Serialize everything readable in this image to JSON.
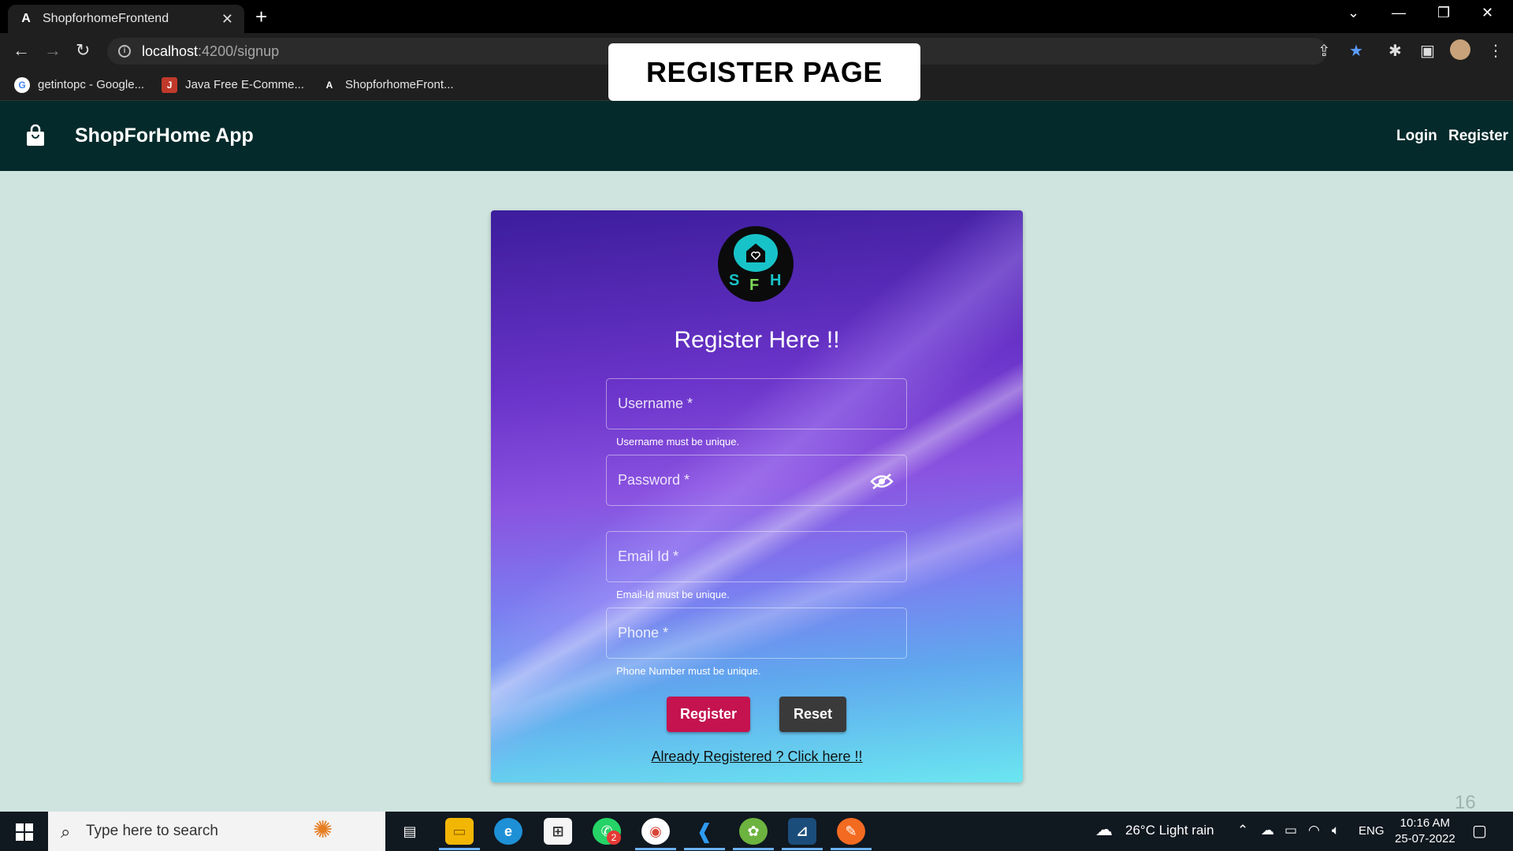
{
  "browser": {
    "tab_title": "ShopforhomeFrontend",
    "url_host": "localhost",
    "url_path": ":4200/signup",
    "bookmarks": [
      {
        "label": "getintopc - Google...",
        "icon": "google-icon"
      },
      {
        "label": "Java Free E-Comme...",
        "icon": "ecommerce-icon"
      },
      {
        "label": "ShopforhomeFront...",
        "icon": "angular-icon"
      }
    ]
  },
  "overlay_label": "REGISTER PAGE",
  "app": {
    "title": "ShopForHome App",
    "nav": {
      "login": "Login",
      "register": "Register"
    }
  },
  "form": {
    "logo_letters": [
      "S",
      "F",
      "H"
    ],
    "title": "Register Here !!",
    "username_placeholder": "Username *",
    "username_hint": "Username must be unique.",
    "password_placeholder": "Password *",
    "email_placeholder": "Email Id *",
    "email_hint": "Email-Id must be unique.",
    "phone_placeholder": "Phone *",
    "phone_hint": "Phone Number must be unique.",
    "register_label": "Register",
    "reset_label": "Reset",
    "login_link": "Already Registered ? Click here !!"
  },
  "page_number": "16",
  "taskbar": {
    "search_placeholder": "Type here to search",
    "whatsapp_badge": "2",
    "weather": "26°C  Light rain",
    "language": "ENG",
    "time": "10:16 AM",
    "date": "25-07-2022"
  },
  "colors": {
    "appbar": "#042a2b",
    "page_bg": "#cfe4df",
    "register_button": "#c4134f",
    "reset_button": "#3a3a3a"
  }
}
